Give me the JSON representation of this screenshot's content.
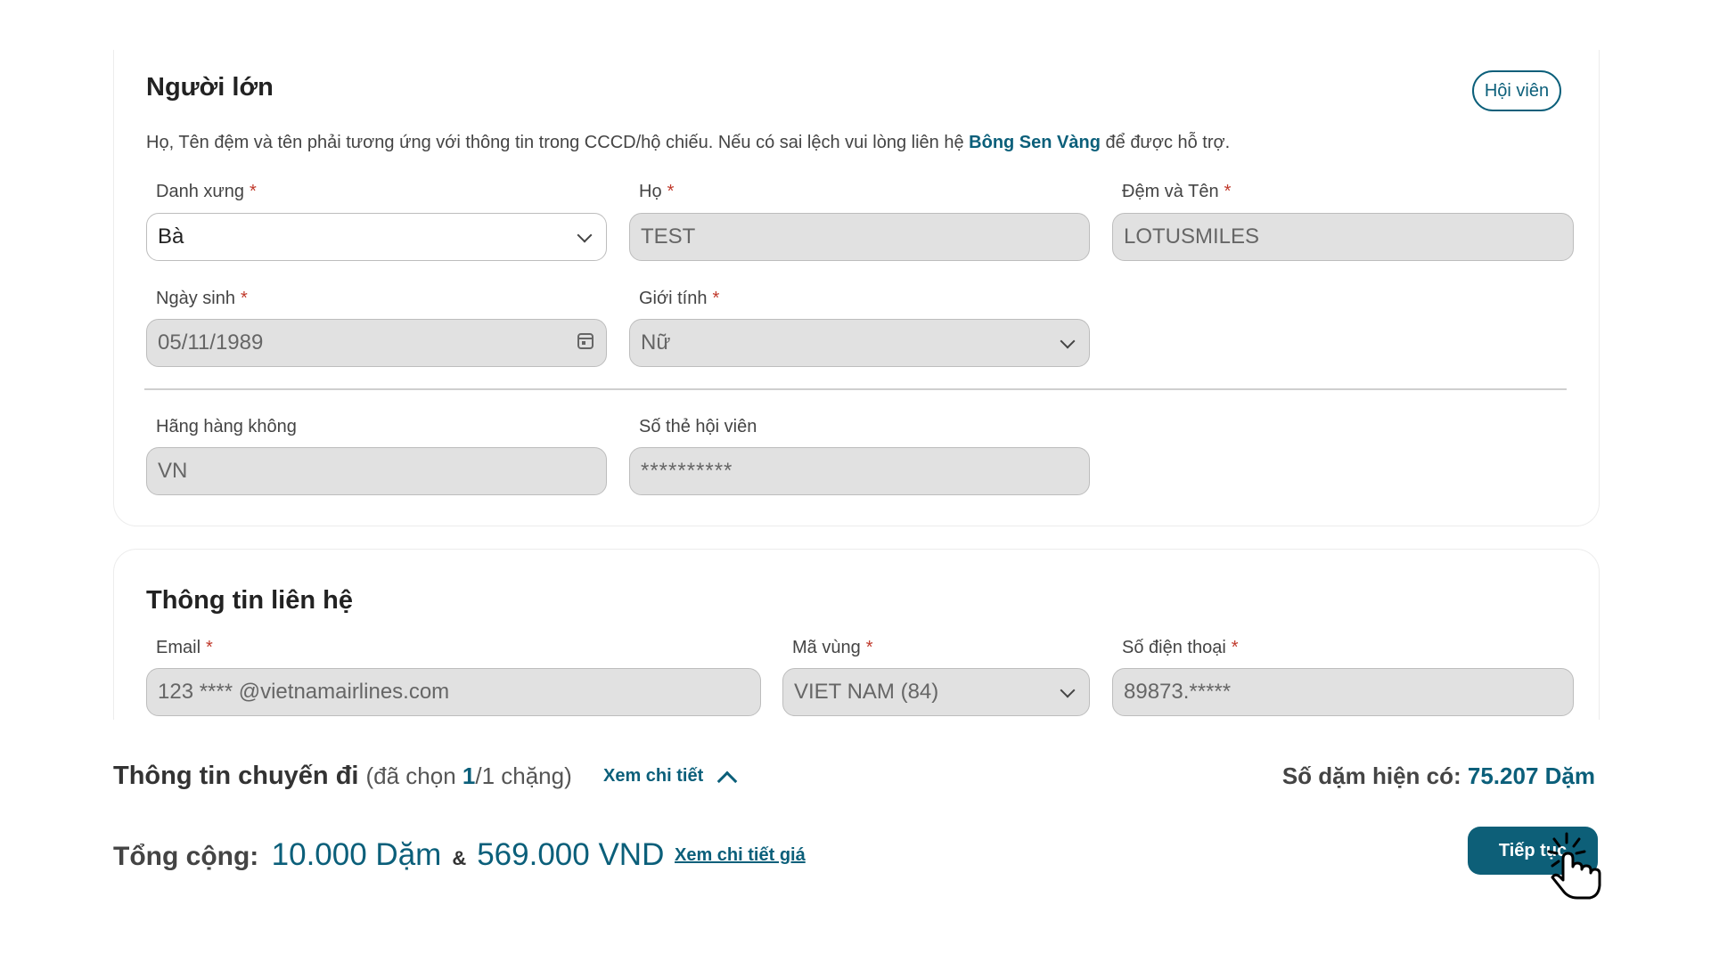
{
  "adult": {
    "title": "Người lớn",
    "member_button": "Hội viên",
    "note_prefix": "Họ, Tên đệm và tên phải tương ứng với thông tin trong CCCD/hộ chiếu. Nếu có sai lệch vui lòng liên hệ ",
    "note_link": "Bông Sen Vàng",
    "note_suffix": " để được hỗ trợ.",
    "required_mark": "*",
    "salutation_label": "Danh xưng",
    "salutation_value": "Bà",
    "lastname_label": "Họ",
    "lastname_value": "TEST",
    "firstname_label": "Đệm và Tên",
    "firstname_value": "LOTUSMILES",
    "dob_label": "Ngày sinh",
    "dob_value": "05/11/1989",
    "gender_label": "Giới tính",
    "gender_value": "Nữ",
    "airline_label": "Hãng hàng không",
    "airline_value": "VN",
    "member_no_label": "Số thẻ hội viên",
    "member_no_value": "**********"
  },
  "contact": {
    "title": "Thông tin liên hệ",
    "email_label": "Email",
    "email_value": "123 **** @vietnamairlines.com",
    "area_label": "Mã vùng",
    "area_value": "VIET NAM (84)",
    "phone_label": "Số điện thoại",
    "phone_value": "89873.*****"
  },
  "summary": {
    "trip_title": "Thông tin chuyến đi",
    "trip_sub_prefix": "(đã chọn ",
    "trip_selected": "1",
    "trip_sub_suffix": "/1 chặng)",
    "detail_link": "Xem chi tiết",
    "miles_label": "Số dặm hiện có:",
    "miles_value": "75.207 Dặm",
    "total_label": "Tổng cộng:",
    "total_miles": "10.000 Dặm",
    "amp": "&",
    "total_money": "569.000 VND",
    "price_link": "Xem chi tiết giá",
    "continue_button": "Tiếp tục"
  },
  "colors": {
    "accent": "#0b5f7a",
    "required": "#c0392b",
    "disabled_field": "#e1e1e1"
  },
  "icons": [
    "chevron-down-icon",
    "calendar-icon",
    "chevron-up-icon",
    "hand-cursor-icon"
  ]
}
